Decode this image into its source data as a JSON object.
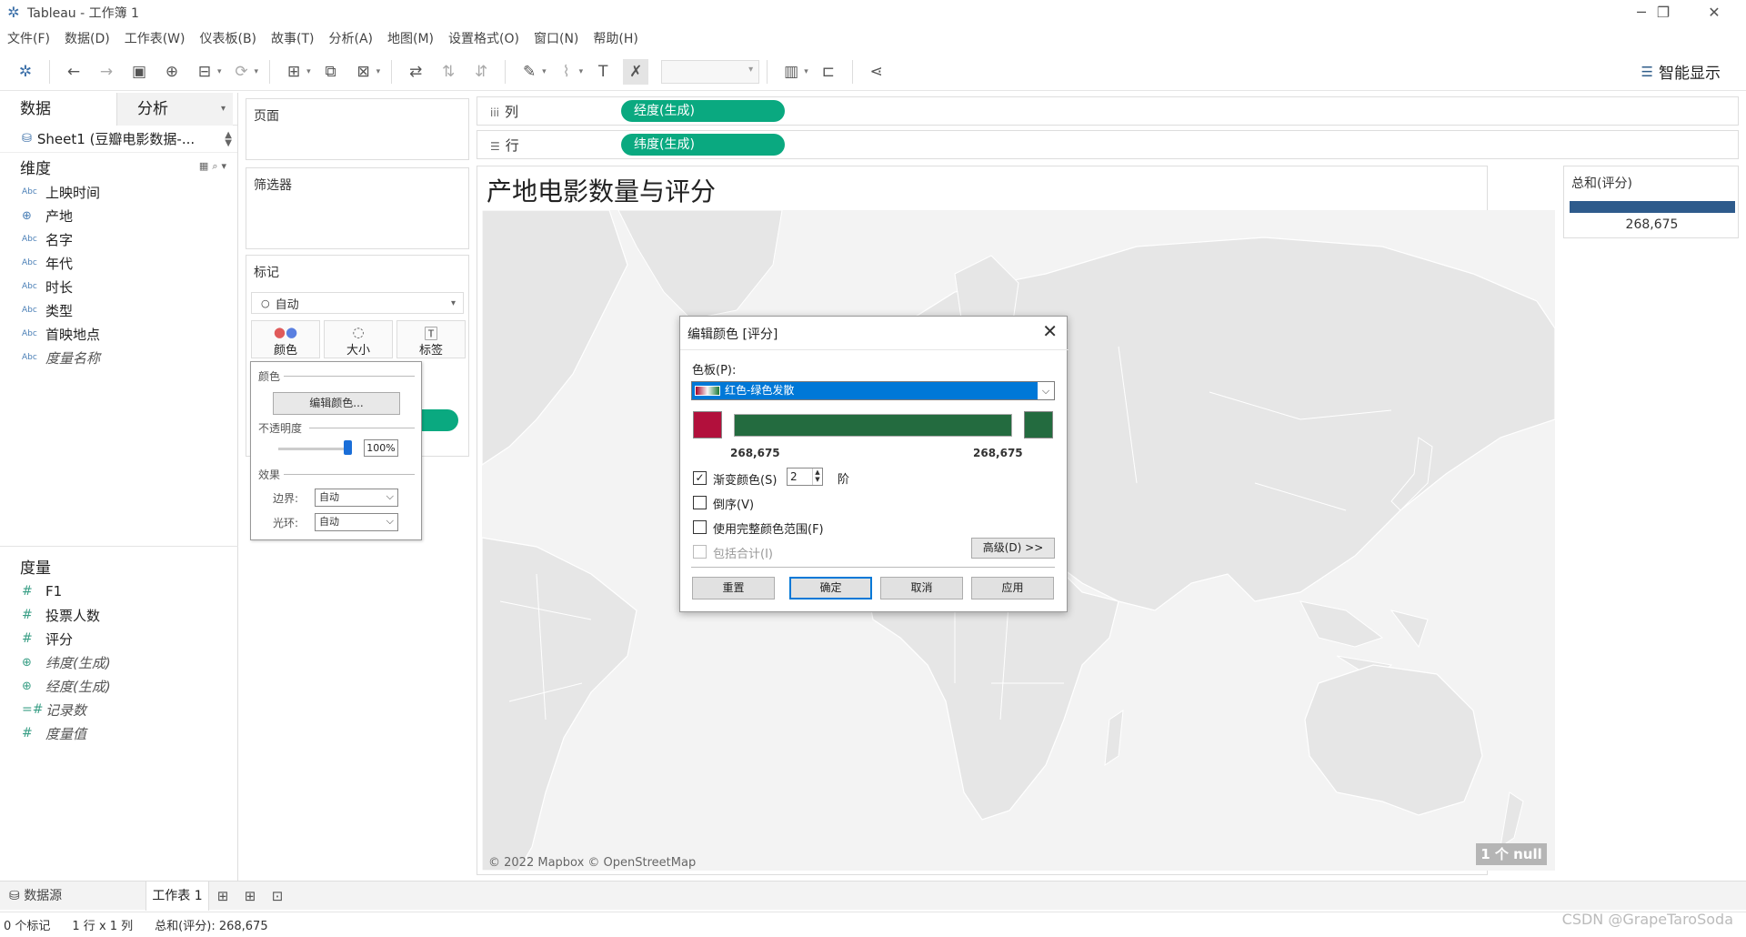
{
  "window": {
    "title": "Tableau - 工作簿 1"
  },
  "menu": [
    "文件(F)",
    "数据(D)",
    "工作表(W)",
    "仪表板(B)",
    "故事(T)",
    "分析(A)",
    "地图(M)",
    "设置格式(O)",
    "窗口(N)",
    "帮助(H)"
  ],
  "toolbar": {
    "show_me_label": "智能显示"
  },
  "left_pane": {
    "tabs": [
      "数据",
      "分析"
    ],
    "datasource": "Sheet1 (豆瓣电影数据-...",
    "dimensions_label": "维度",
    "dimensions": [
      {
        "type": "Abc",
        "name": "上映时间"
      },
      {
        "type": "globe",
        "name": "产地"
      },
      {
        "type": "Abc",
        "name": "名字"
      },
      {
        "type": "Abc",
        "name": "年代"
      },
      {
        "type": "Abc",
        "name": "时长"
      },
      {
        "type": "Abc",
        "name": "类型"
      },
      {
        "type": "Abc",
        "name": "首映地点"
      },
      {
        "type": "Abc",
        "name": "度量名称",
        "italic": true
      }
    ],
    "measures_label": "度量",
    "measures": [
      {
        "type": "#",
        "name": "F1"
      },
      {
        "type": "#",
        "name": "投票人数"
      },
      {
        "type": "#",
        "name": "评分"
      },
      {
        "type": "globe",
        "name": "纬度(生成)",
        "italic": true
      },
      {
        "type": "globe",
        "name": "经度(生成)",
        "italic": true
      },
      {
        "type": "=#",
        "name": "记录数",
        "italic": true
      },
      {
        "type": "#",
        "name": "度量值",
        "italic": true
      }
    ]
  },
  "cards": {
    "pages": "页面",
    "filters": "筛选器",
    "marks": "标记",
    "marks_type": "自动",
    "mark_buttons": [
      "颜色",
      "大小",
      "标签"
    ]
  },
  "color_popup": {
    "color_label": "颜色",
    "edit_color_button": "编辑颜色...",
    "opacity_label": "不透明度",
    "opacity_value": "100%",
    "opacity_level": 1.0,
    "effects_label": "效果",
    "border_label": "边界:",
    "border_value": "自动",
    "halo_label": "光环:",
    "halo_value": "自动"
  },
  "shelves": {
    "columns_label": "列",
    "columns_pill": "经度(生成)",
    "rows_label": "行",
    "rows_pill": "纬度(生成)"
  },
  "view": {
    "title": "产地电影数量与评分",
    "attribution": "© 2022 Mapbox © OpenStreetMap",
    "null_badge": "1 个 null"
  },
  "legend": {
    "title": "总和(评分)",
    "value": "268,675",
    "color": "#2e5b8c"
  },
  "dialog": {
    "title": "编辑颜色 [评分]",
    "palette_label": "色板(P):",
    "palette_value": "红色-绿色发散",
    "start_color": "#b2103c",
    "end_color": "#236b3f",
    "range_min": "268,675",
    "range_max": "268,675",
    "stepped_label": "渐变颜色(S)",
    "stepped_checked": true,
    "steps_value": "2",
    "steps_unit": "阶",
    "reversed_label": "倒序(V)",
    "full_range_label": "使用完整颜色范围(F)",
    "include_totals_label": "包括合计(I)",
    "advanced_button": "高级(D) >>",
    "buttons": [
      "重置",
      "确定",
      "取消",
      "应用"
    ]
  },
  "sheet_tabs": {
    "datasource": "数据源",
    "sheet": "工作表 1"
  },
  "status": {
    "marks": "0 个标记",
    "dims": "1 行 x 1 列",
    "sum": "总和(评分): 268,675"
  },
  "watermark": "CSDN @GrapeTaroSoda",
  "colors": {
    "pill": "#0aa980",
    "accent": "#0078d7"
  }
}
